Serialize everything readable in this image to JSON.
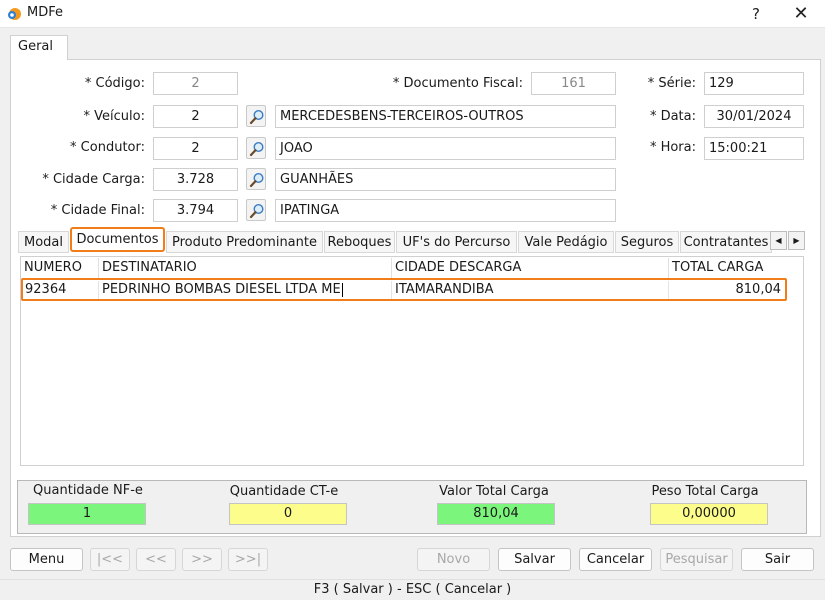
{
  "window": {
    "title": "MDFe",
    "help_icon": "?",
    "close_icon": "✕"
  },
  "tabs": {
    "geral": "Geral"
  },
  "form": {
    "codigo": {
      "label": "* Código:",
      "value": "2"
    },
    "documento_fiscal": {
      "label": "* Documento Fiscal:",
      "value": "161"
    },
    "serie": {
      "label": "* Série:",
      "value": "129"
    },
    "veiculo": {
      "label": "* Veículo:",
      "code": "2",
      "name": "MERCEDESBENS-TERCEIROS-OUTROS"
    },
    "data": {
      "label": "* Data:",
      "value": "30/01/2024"
    },
    "condutor": {
      "label": "* Condutor:",
      "code": "2",
      "name": "JOAO"
    },
    "hora": {
      "label": "* Hora:",
      "value": "15:00:21"
    },
    "cidade_carga": {
      "label": "* Cidade Carga:",
      "code": "3.728",
      "name": "GUANHÃES"
    },
    "cidade_final": {
      "label": "* Cidade Final:",
      "code": "3.794",
      "name": "IPATINGA"
    }
  },
  "subtabs": [
    "Modal",
    "Documentos",
    "Produto Predominante",
    "Reboques",
    "UF's do Percurso",
    "Vale Pedágio",
    "Seguros",
    "Contratantes"
  ],
  "active_subtab": "Documentos",
  "table": {
    "columns": [
      "NUMERO",
      "DESTINATARIO",
      "CIDADE DESCARGA",
      "TOTAL CARGA"
    ],
    "rows": [
      [
        "92364",
        "PEDRINHO BOMBAS DIESEL LTDA ME",
        "ITAMARANDIBA",
        "810,04"
      ]
    ]
  },
  "totals": {
    "qtd_nfe": {
      "label": "Quantidade NF-e",
      "value": "1"
    },
    "qtd_cte": {
      "label": "Quantidade CT-e",
      "value": "0"
    },
    "valor_total": {
      "label": "Valor Total Carga",
      "value": "810,04"
    },
    "peso_total": {
      "label": "Peso Total Carga",
      "value": "0,00000"
    }
  },
  "buttons": {
    "menu": "Menu",
    "first": "|<<",
    "prev": "<<",
    "next": ">>",
    "last": ">>|",
    "novo": "Novo",
    "salvar": "Salvar",
    "cancelar": "Cancelar",
    "pesquisar": "Pesquisar",
    "sair": "Sair"
  },
  "status_bar": "F3 ( Salvar )   -   ESC ( Cancelar )",
  "colors": {
    "accent": "#f07d1a",
    "green": "#7cf57c",
    "yellow": "#fdfd8c"
  }
}
